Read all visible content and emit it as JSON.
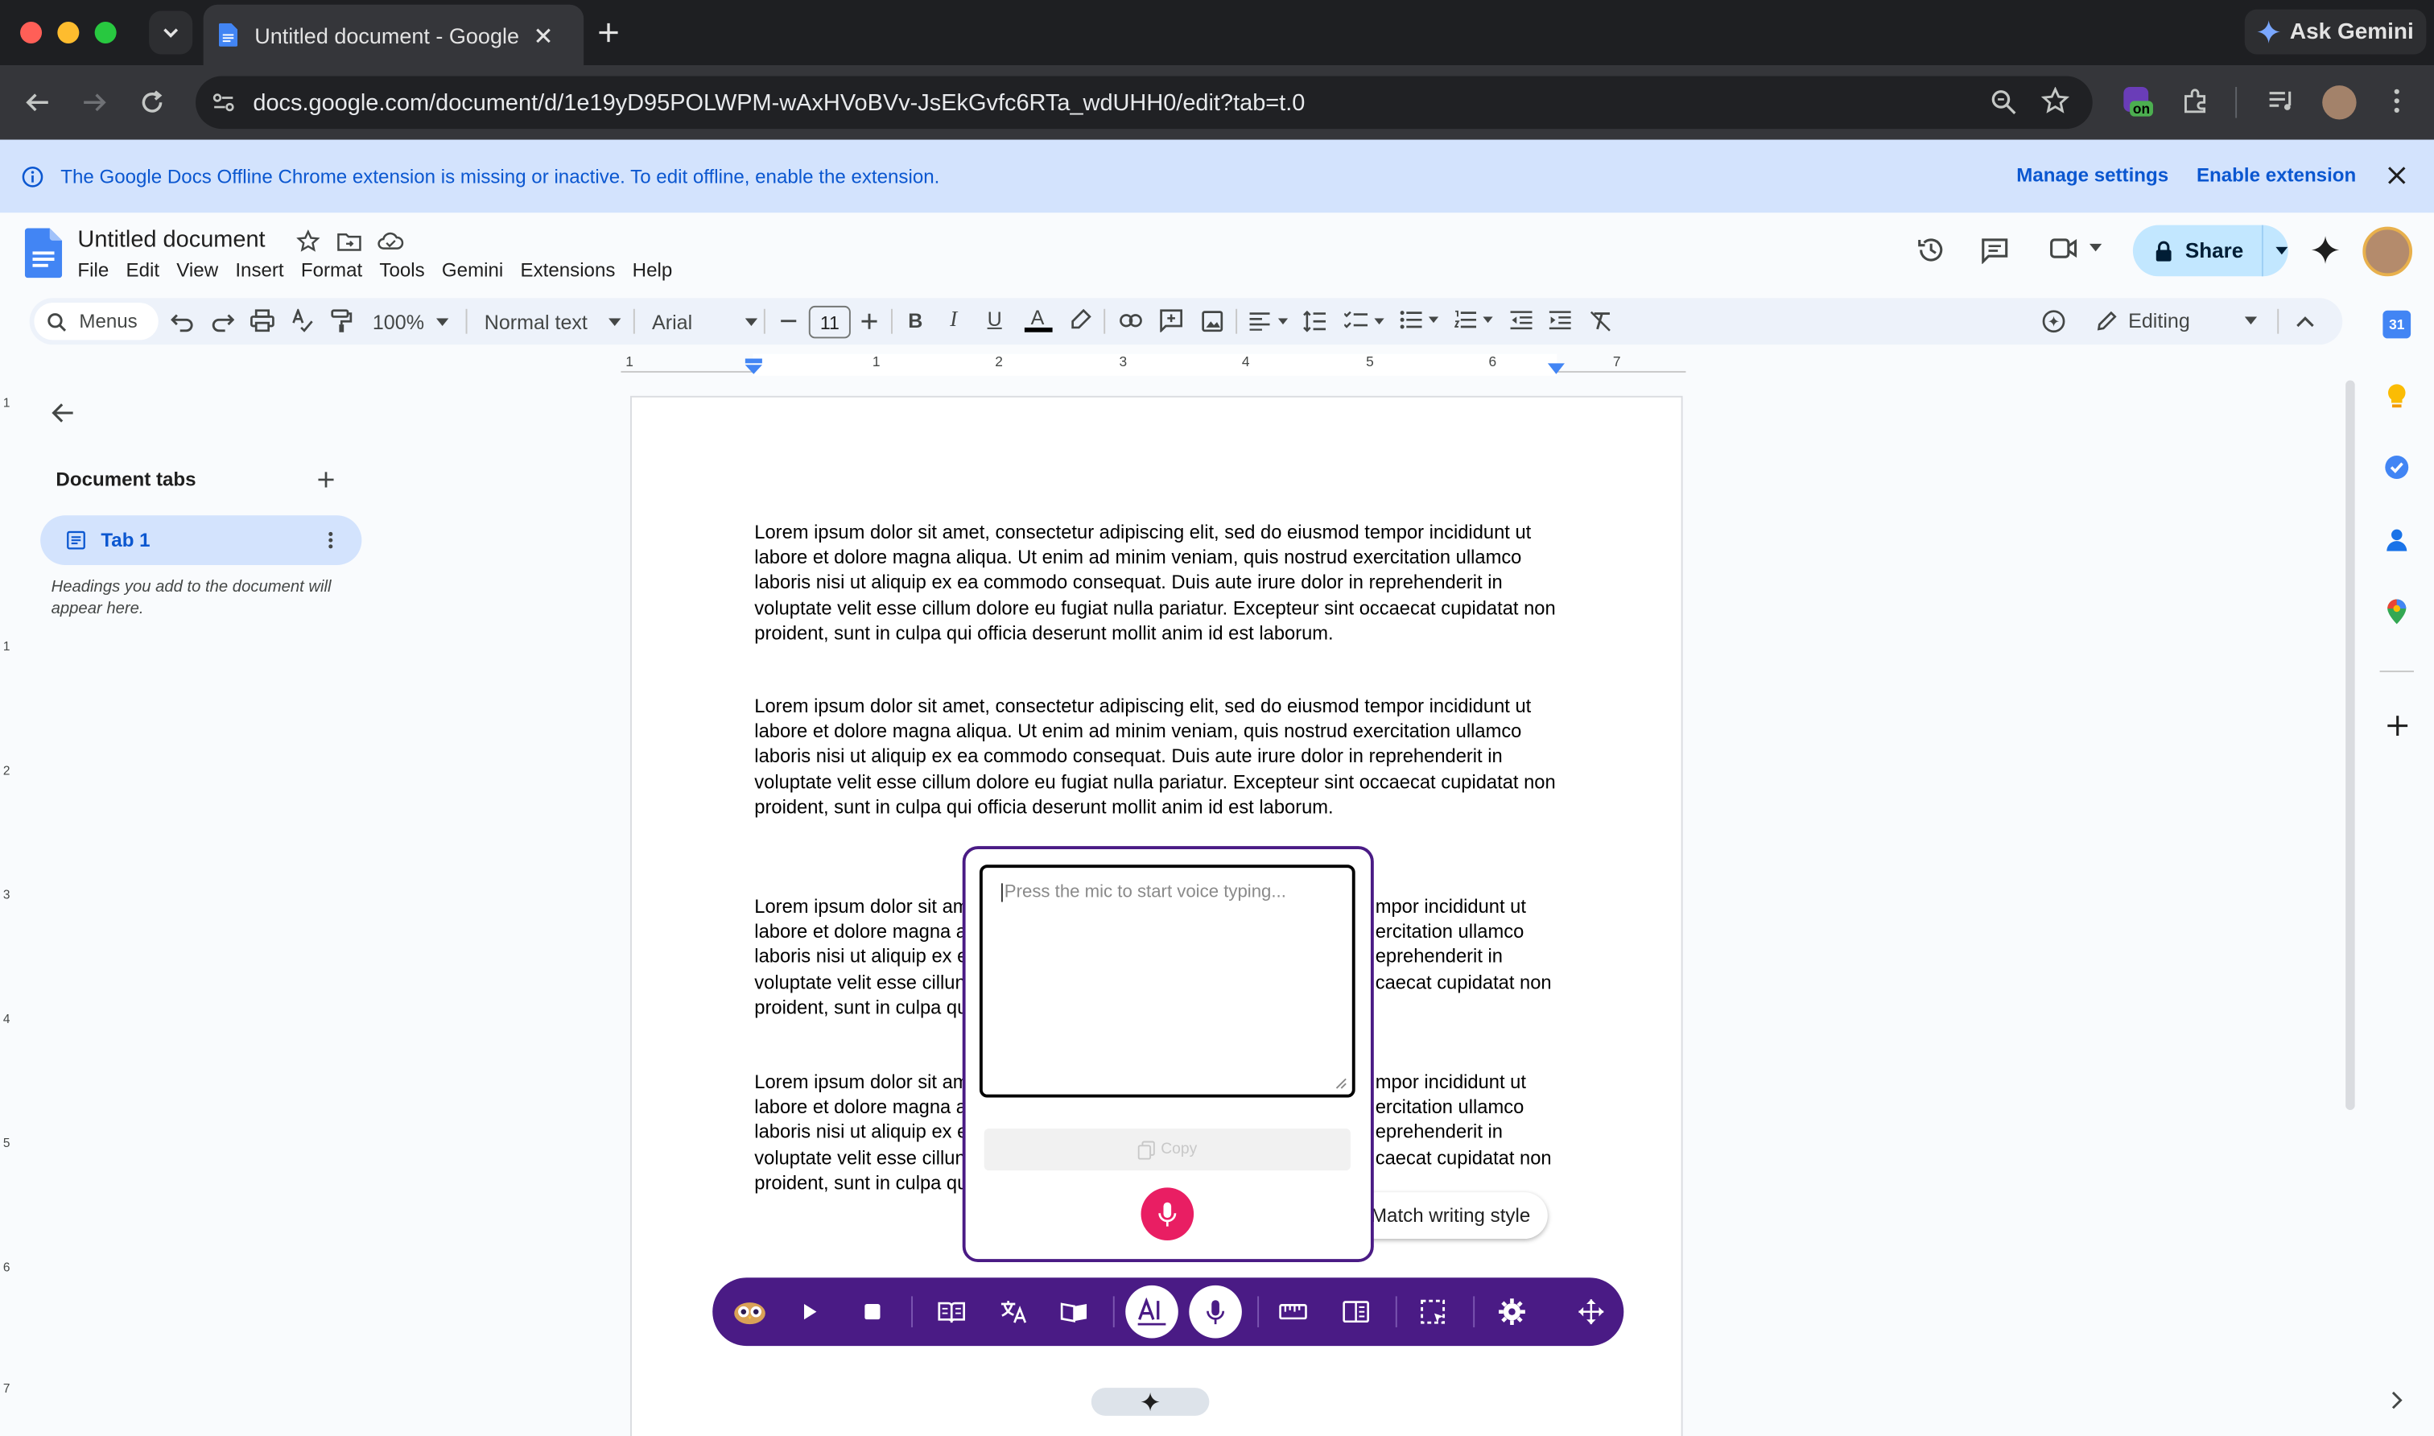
{
  "browser": {
    "tab_title": "Untitled document - Google D",
    "url": "docs.google.com/document/d/1e19yD95POLWPM-wAxHVoBVv-JsEkGvfc6RTa_wdUHH0/edit?tab=t.0",
    "ask_gemini": "Ask Gemini",
    "extension_badge": "on"
  },
  "infobar": {
    "message": "The Google Docs Offline Chrome extension is missing or inactive. To edit offline, enable the extension.",
    "manage": "Manage settings",
    "enable": "Enable extension"
  },
  "doc": {
    "title": "Untitled document",
    "menus": [
      "File",
      "Edit",
      "View",
      "Insert",
      "Format",
      "Tools",
      "Gemini",
      "Extensions",
      "Help"
    ],
    "share": "Share"
  },
  "toolbar": {
    "search": "Menus",
    "zoom": "100%",
    "style": "Normal text",
    "font": "Arial",
    "font_size": "11",
    "mode": "Editing"
  },
  "ruler": {
    "marks": [
      "1",
      "1",
      "2",
      "3",
      "4",
      "5",
      "6",
      "7"
    ],
    "vmarks": [
      "1",
      "1",
      "2",
      "3",
      "4",
      "5",
      "6",
      "7"
    ]
  },
  "sidebar": {
    "heading": "Document tabs",
    "tab": "Tab 1",
    "hint": "Headings you add to the document will appear here."
  },
  "body": {
    "p1": "Lorem ipsum dolor sit amet, consectetur adipiscing elit, sed do eiusmod tempor incididunt ut\nlabore et dolore magna aliqua. Ut enim ad minim veniam, quis nostrud exercitation ullamco\nlaboris nisi ut aliquip ex ea commodo consequat. Duis aute irure dolor in reprehenderit in\nvoluptate velit esse cillum dolore eu fugiat nulla pariatur. Excepteur sint occaecat cupidatat non\nproident, sunt in culpa qui officia deserunt mollit anim id est laborum.",
    "p2": "Lorem ipsum dolor sit amet, consectetur adipiscing elit, sed do eiusmod tempor incididunt ut\nlabore et dolore magna aliqua. Ut enim ad minim veniam, quis nostrud exercitation ullamco\nlaboris nisi ut aliquip ex ea commodo consequat. Duis aute irure dolor in reprehenderit in\nvoluptate velit esse cillum dolore eu fugiat nulla pariatur. Excepteur sint occaecat cupidatat non\nproident, sunt in culpa qui officia deserunt mollit anim id est laborum.",
    "p3_left": "Lorem ipsum dolor sit am\nlabore et dolore magna a\nlaboris nisi ut aliquip ex e\nvoluptate velit esse cillun\nproident, sunt in culpa qu",
    "p3_right": "mpor incididunt ut\nercitation ullamco\neprehenderit in\ncaecat cupidatat non",
    "p4_left": "Lorem ipsum dolor sit am\nlabore et dolore magna a\nlaboris nisi ut aliquip ex e\nvoluptate velit esse cillun\nproident, sunt in culpa qu",
    "p4_right": "mpor incididunt ut\nercitation ullamco\neprehenderit in\ncaecat cupidatat non"
  },
  "voice": {
    "placeholder": "Press the mic to start voice typing...",
    "copy": "Copy"
  },
  "match_style": "Match writing style",
  "colors": {
    "assist_bar": "#4a1b85",
    "mic": "#e91e63",
    "share_bg": "#c2e7ff",
    "infobar_bg": "#d3e3fd"
  }
}
